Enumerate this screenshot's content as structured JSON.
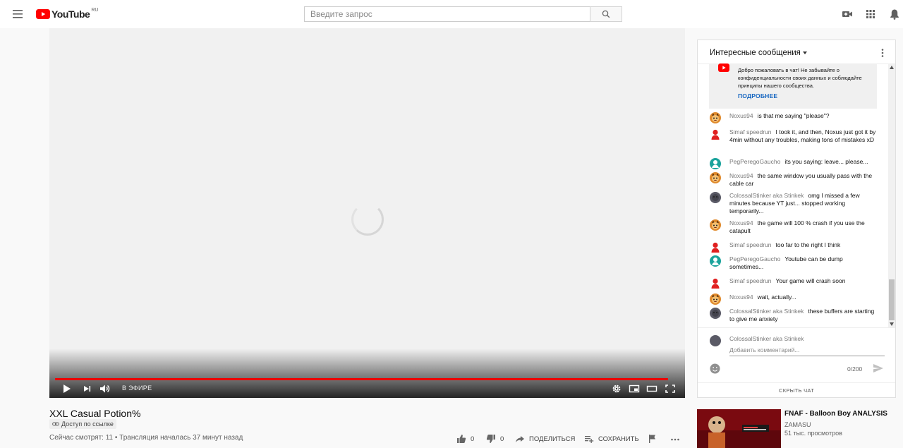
{
  "header": {
    "logo_text": "YouTube",
    "region": "RU",
    "search_placeholder": "Введите запрос"
  },
  "colors": {
    "brand_red": "#ff0000",
    "progress": "#ee0000",
    "link_blue": "#1565c0"
  },
  "player": {
    "live_label": "В ЭФИРЕ"
  },
  "video": {
    "title": "XXL Casual Potion%",
    "access": "Доступ по ссылке",
    "meta": "Сейчас смотрят: 11 • Трансляция началась 37 минут назад",
    "likes": "0",
    "dislikes": "0",
    "share_label": "ПОДЕЛИТЬСЯ",
    "save_label": "СОХРАНИТЬ"
  },
  "chat": {
    "title": "Интересные сообщения",
    "welcome_text": "Добро пожаловать в чат! Не забывайте о конфиденциальности своих данных и соблюдайте принципы нашего сообщества.",
    "welcome_link": "ПОДРОБНЕЕ",
    "messages": [
      {
        "author": "Noxus94",
        "text": "is that me saying \"please\"?",
        "avatar": "cat"
      },
      {
        "author": "Simaf speedrun",
        "text": "I took it, and then, Noxus just got it by 4min without any troubles, making tons of mistakes xD",
        "avatar": "red-person"
      },
      {
        "author": "PegPeregoGaucho",
        "text": "its you saying: leave... please...",
        "avatar": "teal-person"
      },
      {
        "author": "Noxus94",
        "text": "the same window you usually pass with the cable car",
        "avatar": "cat"
      },
      {
        "author": "ColossalStinker aka Stinkek",
        "text": "omg I missed a few minutes because YT just... stopped working temporarily...",
        "avatar": "gray"
      },
      {
        "author": "Noxus94",
        "text": "the game will 100 % crash if you use the catapult",
        "avatar": "cat"
      },
      {
        "author": "Simaf speedrun",
        "text": "too far to the right I think",
        "avatar": "red-person"
      },
      {
        "author": "PegPeregoGaucho",
        "text": "Youtube can be dump sometimes...",
        "avatar": "teal-person"
      },
      {
        "author": "Simaf speedrun",
        "text": "Your game will crash soon",
        "avatar": "red-person"
      },
      {
        "author": "Noxus94",
        "text": "wait, actually...",
        "avatar": "cat"
      },
      {
        "author": "ColossalStinker aka Stinkek",
        "text": "these buffers are starting to give me anxiety",
        "avatar": "gray"
      }
    ],
    "composer_name": "ColossalStinker aka Stinkek",
    "composer_placeholder": "Добавить комментарий...",
    "counter": "0/200",
    "hide_label": "СКРЫТЬ ЧАТ"
  },
  "recommendation": {
    "title": "FNAF - Balloon Boy ANALYSIS",
    "channel": "ZAMASU",
    "views": "51 тыс. просмотров"
  }
}
